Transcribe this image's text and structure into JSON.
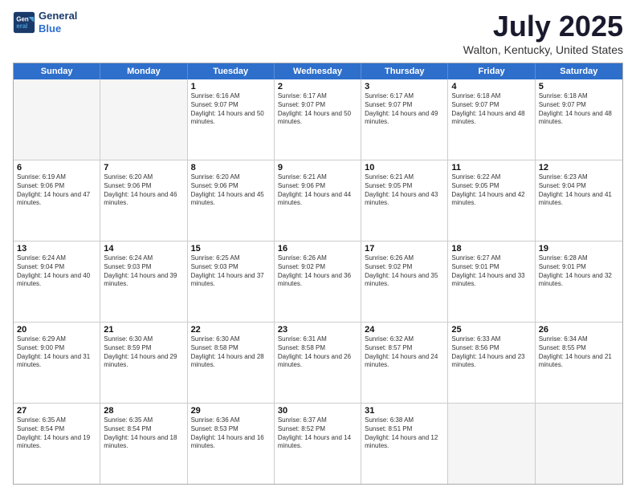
{
  "header": {
    "logo_line1": "General",
    "logo_line2": "Blue",
    "title": "July 2025",
    "subtitle": "Walton, Kentucky, United States"
  },
  "weekdays": [
    "Sunday",
    "Monday",
    "Tuesday",
    "Wednesday",
    "Thursday",
    "Friday",
    "Saturday"
  ],
  "weeks": [
    [
      {
        "day": "",
        "empty": true
      },
      {
        "day": "",
        "empty": true
      },
      {
        "day": "1",
        "sunrise": "6:16 AM",
        "sunset": "9:07 PM",
        "daylight": "14 hours and 50 minutes."
      },
      {
        "day": "2",
        "sunrise": "6:17 AM",
        "sunset": "9:07 PM",
        "daylight": "14 hours and 50 minutes."
      },
      {
        "day": "3",
        "sunrise": "6:17 AM",
        "sunset": "9:07 PM",
        "daylight": "14 hours and 49 minutes."
      },
      {
        "day": "4",
        "sunrise": "6:18 AM",
        "sunset": "9:07 PM",
        "daylight": "14 hours and 48 minutes."
      },
      {
        "day": "5",
        "sunrise": "6:18 AM",
        "sunset": "9:07 PM",
        "daylight": "14 hours and 48 minutes."
      }
    ],
    [
      {
        "day": "6",
        "sunrise": "6:19 AM",
        "sunset": "9:06 PM",
        "daylight": "14 hours and 47 minutes."
      },
      {
        "day": "7",
        "sunrise": "6:20 AM",
        "sunset": "9:06 PM",
        "daylight": "14 hours and 46 minutes."
      },
      {
        "day": "8",
        "sunrise": "6:20 AM",
        "sunset": "9:06 PM",
        "daylight": "14 hours and 45 minutes."
      },
      {
        "day": "9",
        "sunrise": "6:21 AM",
        "sunset": "9:06 PM",
        "daylight": "14 hours and 44 minutes."
      },
      {
        "day": "10",
        "sunrise": "6:21 AM",
        "sunset": "9:05 PM",
        "daylight": "14 hours and 43 minutes."
      },
      {
        "day": "11",
        "sunrise": "6:22 AM",
        "sunset": "9:05 PM",
        "daylight": "14 hours and 42 minutes."
      },
      {
        "day": "12",
        "sunrise": "6:23 AM",
        "sunset": "9:04 PM",
        "daylight": "14 hours and 41 minutes."
      }
    ],
    [
      {
        "day": "13",
        "sunrise": "6:24 AM",
        "sunset": "9:04 PM",
        "daylight": "14 hours and 40 minutes."
      },
      {
        "day": "14",
        "sunrise": "6:24 AM",
        "sunset": "9:03 PM",
        "daylight": "14 hours and 39 minutes."
      },
      {
        "day": "15",
        "sunrise": "6:25 AM",
        "sunset": "9:03 PM",
        "daylight": "14 hours and 37 minutes."
      },
      {
        "day": "16",
        "sunrise": "6:26 AM",
        "sunset": "9:02 PM",
        "daylight": "14 hours and 36 minutes."
      },
      {
        "day": "17",
        "sunrise": "6:26 AM",
        "sunset": "9:02 PM",
        "daylight": "14 hours and 35 minutes."
      },
      {
        "day": "18",
        "sunrise": "6:27 AM",
        "sunset": "9:01 PM",
        "daylight": "14 hours and 33 minutes."
      },
      {
        "day": "19",
        "sunrise": "6:28 AM",
        "sunset": "9:01 PM",
        "daylight": "14 hours and 32 minutes."
      }
    ],
    [
      {
        "day": "20",
        "sunrise": "6:29 AM",
        "sunset": "9:00 PM",
        "daylight": "14 hours and 31 minutes."
      },
      {
        "day": "21",
        "sunrise": "6:30 AM",
        "sunset": "8:59 PM",
        "daylight": "14 hours and 29 minutes."
      },
      {
        "day": "22",
        "sunrise": "6:30 AM",
        "sunset": "8:58 PM",
        "daylight": "14 hours and 28 minutes."
      },
      {
        "day": "23",
        "sunrise": "6:31 AM",
        "sunset": "8:58 PM",
        "daylight": "14 hours and 26 minutes."
      },
      {
        "day": "24",
        "sunrise": "6:32 AM",
        "sunset": "8:57 PM",
        "daylight": "14 hours and 24 minutes."
      },
      {
        "day": "25",
        "sunrise": "6:33 AM",
        "sunset": "8:56 PM",
        "daylight": "14 hours and 23 minutes."
      },
      {
        "day": "26",
        "sunrise": "6:34 AM",
        "sunset": "8:55 PM",
        "daylight": "14 hours and 21 minutes."
      }
    ],
    [
      {
        "day": "27",
        "sunrise": "6:35 AM",
        "sunset": "8:54 PM",
        "daylight": "14 hours and 19 minutes."
      },
      {
        "day": "28",
        "sunrise": "6:35 AM",
        "sunset": "8:54 PM",
        "daylight": "14 hours and 18 minutes."
      },
      {
        "day": "29",
        "sunrise": "6:36 AM",
        "sunset": "8:53 PM",
        "daylight": "14 hours and 16 minutes."
      },
      {
        "day": "30",
        "sunrise": "6:37 AM",
        "sunset": "8:52 PM",
        "daylight": "14 hours and 14 minutes."
      },
      {
        "day": "31",
        "sunrise": "6:38 AM",
        "sunset": "8:51 PM",
        "daylight": "14 hours and 12 minutes."
      },
      {
        "day": "",
        "empty": true
      },
      {
        "day": "",
        "empty": true
      }
    ]
  ]
}
